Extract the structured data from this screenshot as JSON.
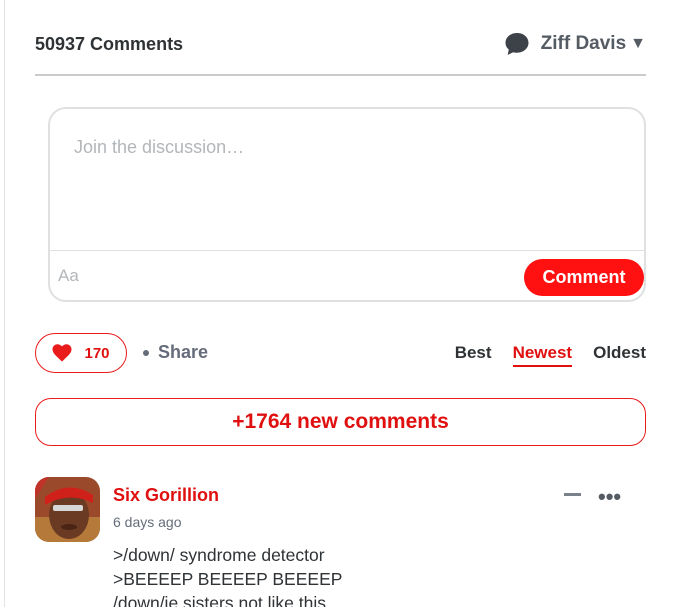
{
  "header": {
    "comment_count": "50937 Comments",
    "org_name": "Ziff Davis",
    "org_icon": "chat-bubble-icon",
    "caret": "▼"
  },
  "composer": {
    "placeholder": "Join the discussion…",
    "format_label": "Aa",
    "submit_label": "Comment"
  },
  "toolbar": {
    "like_count": "170",
    "share_label": "Share",
    "sort_options": [
      "Best",
      "Newest",
      "Oldest"
    ],
    "active_sort": "Newest"
  },
  "new_comments_label": "+1764 new comments",
  "comments": [
    {
      "author": "Six Gorillion",
      "time": "6 days ago",
      "lines": [
        ">/down/ syndrome detector",
        ">BEEEEP BEEEEP BEEEEP",
        "/down/ie sisters not like this"
      ]
    }
  ],
  "colors": {
    "accent": "#e01010",
    "button": "#ff1111",
    "muted": "#656c7a"
  }
}
